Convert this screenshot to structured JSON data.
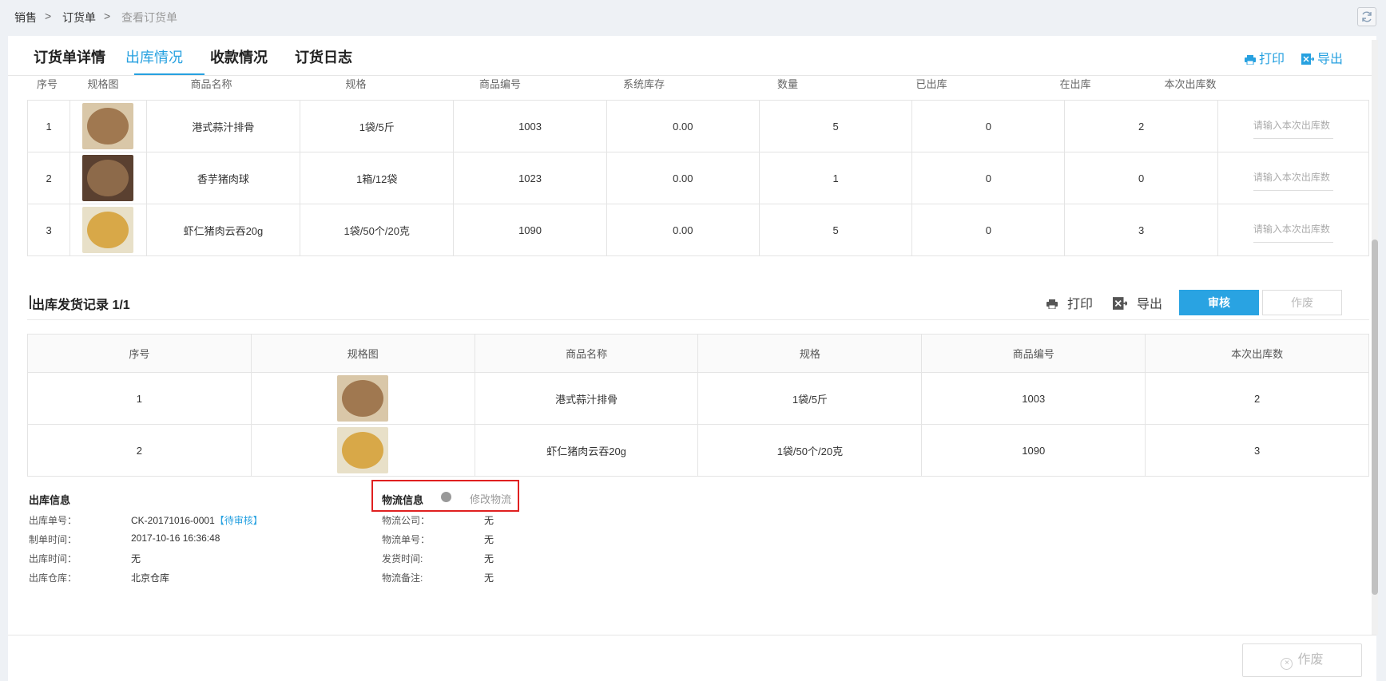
{
  "breadcrumb": {
    "level1": "销售",
    "level2": "订货单",
    "level3": "查看订货单",
    "sep": ">"
  },
  "tabs": [
    {
      "label": "订货单详情"
    },
    {
      "label": "出库情况"
    },
    {
      "label": "收款情况"
    },
    {
      "label": "订货日志"
    }
  ],
  "header_actions": {
    "print": "打印",
    "export": "导出"
  },
  "stock_table": {
    "columns": [
      "序号",
      "规格图",
      "商品名称",
      "规格",
      "商品编号",
      "系统库存",
      "数量",
      "已出库",
      "在出库",
      "本次出库数"
    ],
    "placeholder": "请输入本次出库数",
    "rows": [
      {
        "no": "1",
        "name": "港式蒜汁排骨",
        "spec": "1袋/5斤",
        "code": "1003",
        "stock": "0.00",
        "qty": "5",
        "shipped": "0",
        "shipping": "2"
      },
      {
        "no": "2",
        "name": "香芋猪肉球",
        "spec": "1箱/12袋",
        "code": "1023",
        "stock": "0.00",
        "qty": "1",
        "shipped": "0",
        "shipping": "0"
      },
      {
        "no": "3",
        "name": "虾仁猪肉云吞20g",
        "spec": "1袋/50个/20克",
        "code": "1090",
        "stock": "0.00",
        "qty": "5",
        "shipped": "0",
        "shipping": "3"
      }
    ]
  },
  "record_section": {
    "title": "出库发货记录 1/1",
    "print": "打印",
    "export": "导出",
    "audit_button": "审核",
    "void_button": "作废"
  },
  "record_table": {
    "columns": [
      "序号",
      "规格图",
      "商品名称",
      "规格",
      "商品编号",
      "本次出库数"
    ],
    "rows": [
      {
        "no": "1",
        "name": "港式蒜汁排骨",
        "spec": "1袋/5斤",
        "code": "1003",
        "out": "2"
      },
      {
        "no": "2",
        "name": "虾仁猪肉云吞20g",
        "spec": "1袋/50个/20克",
        "code": "1090",
        "out": "3"
      }
    ]
  },
  "outbound_info": {
    "title": "出库信息",
    "order_no_label": "出库单号：",
    "order_no": "CK-20171016-0001",
    "status": "【待审核】",
    "created_label": "制单时间：",
    "created": "2017-10-16 16:36:48",
    "out_time_label": "出库时间：",
    "out_time": "无",
    "warehouse_label": "出库仓库：",
    "warehouse": "北京仓库"
  },
  "logistics_info": {
    "title": "物流信息",
    "edit_link": "修改物流",
    "company_label": "物流公司：",
    "company": "无",
    "tracking_label": "物流单号：",
    "tracking": "无",
    "ship_time_label": "发货时间:",
    "ship_time": "无",
    "remark_label": "物流备注:",
    "remark": "无"
  },
  "footer": {
    "void_button": "作废"
  },
  "colors": {
    "accent": "#27a1e0",
    "highlight": "#e02020"
  }
}
